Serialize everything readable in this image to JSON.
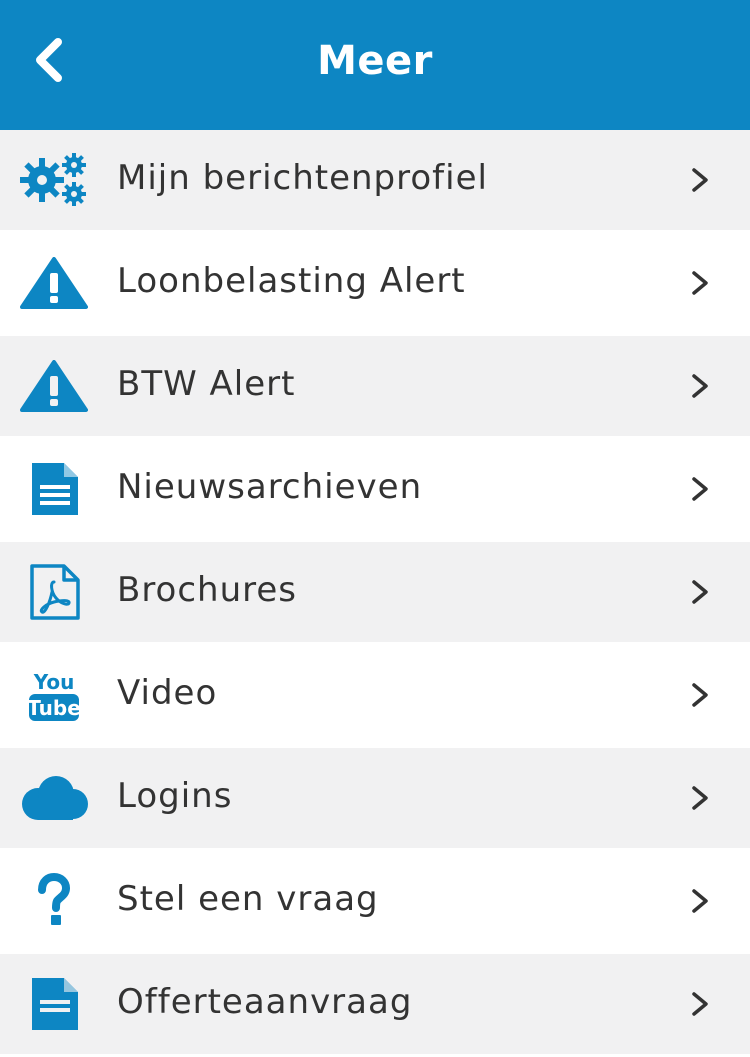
{
  "header": {
    "title": "Meer",
    "back_icon": "chevron-left-icon"
  },
  "colors": {
    "accent": "#0d86c3",
    "text": "#333333",
    "row_alt": "#f1f1f2"
  },
  "menu": {
    "items": [
      {
        "label": "Mijn berichtenprofiel",
        "icon": "gears-icon"
      },
      {
        "label": "Loonbelasting Alert",
        "icon": "warning-icon"
      },
      {
        "label": "BTW Alert",
        "icon": "warning-icon"
      },
      {
        "label": "Nieuwsarchieven",
        "icon": "document-icon"
      },
      {
        "label": "Brochures",
        "icon": "pdf-icon"
      },
      {
        "label": "Video",
        "icon": "youtube-icon"
      },
      {
        "label": "Logins",
        "icon": "cloud-icon"
      },
      {
        "label": "Stel een vraag",
        "icon": "question-icon"
      },
      {
        "label": "Offerteaanvraag",
        "icon": "document-icon"
      }
    ]
  }
}
